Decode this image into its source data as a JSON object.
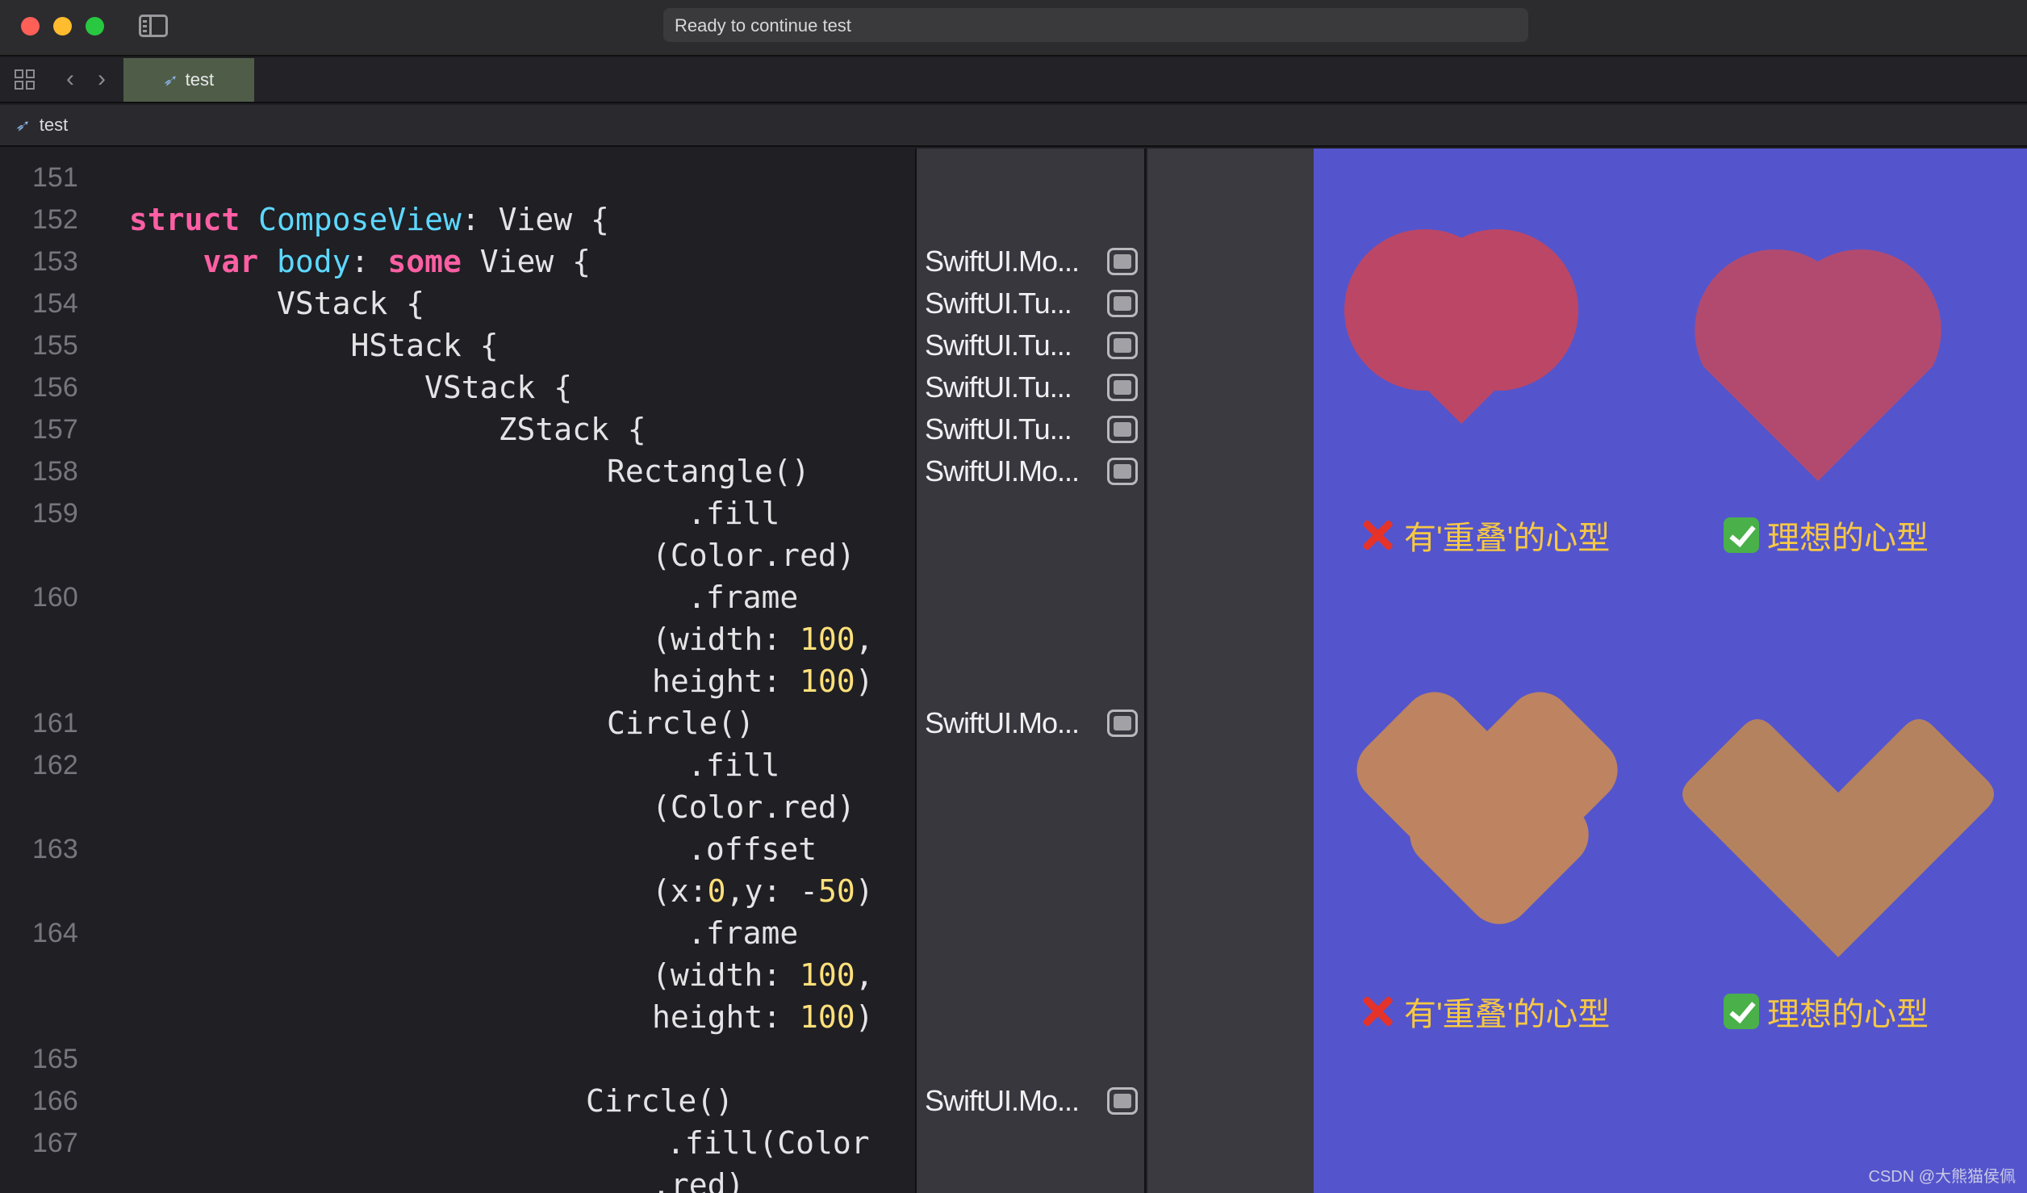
{
  "window": {
    "activity_status": "Ready to continue test"
  },
  "tabs": [
    {
      "label": "test",
      "active": true
    }
  ],
  "breadcrumb": {
    "file": "test"
  },
  "editor": {
    "lines": [
      {
        "number": "151",
        "code": ""
      },
      {
        "number": "152",
        "code": "struct ComposeView: View {"
      },
      {
        "number": "153",
        "code": "    var body: some View {"
      },
      {
        "number": "154",
        "code": "        VStack {"
      },
      {
        "number": "155",
        "code": "            HStack {"
      },
      {
        "number": "156",
        "code": "                VStack {"
      },
      {
        "number": "157",
        "code": "                    ZStack {"
      },
      {
        "number": "158",
        "code": "Rectangle()"
      },
      {
        "number": "159",
        "code": ".fill"
      },
      {
        "number": "",
        "code": "(Color.red)"
      },
      {
        "number": "160",
        "code": ".frame"
      },
      {
        "number": "",
        "code": "(width: 100,"
      },
      {
        "number": "",
        "code": "height: 100)"
      },
      {
        "number": "161",
        "code": "Circle()"
      },
      {
        "number": "162",
        "code": ".fill"
      },
      {
        "number": "",
        "code": "(Color.red)"
      },
      {
        "number": "163",
        "code": ".offset"
      },
      {
        "number": "",
        "code": "(x:0,y: -50)"
      },
      {
        "number": "164",
        "code": ".frame"
      },
      {
        "number": "",
        "code": "(width: 100,"
      },
      {
        "number": "",
        "code": "height: 100)"
      },
      {
        "number": "165",
        "code": ""
      },
      {
        "number": "166",
        "code": "Circle()"
      },
      {
        "number": "167",
        "code": ".fill(Color"
      },
      {
        "number": "",
        "code": ".red)"
      }
    ]
  },
  "results": [
    {
      "line": "153",
      "label": "SwiftUI.Mo..."
    },
    {
      "line": "154",
      "label": "SwiftUI.Tu..."
    },
    {
      "line": "155",
      "label": "SwiftUI.Tu..."
    },
    {
      "line": "156",
      "label": "SwiftUI.Tu..."
    },
    {
      "line": "157",
      "label": "SwiftUI.Tu..."
    },
    {
      "line": "158",
      "label": "SwiftUI.Mo..."
    },
    {
      "line": "161",
      "label": "SwiftUI.Mo..."
    },
    {
      "line": "166",
      "label": "SwiftUI.Mo..."
    }
  ],
  "preview": {
    "captions": {
      "overlap_label": "有'重叠'的心型",
      "ideal_label": "理想的心型"
    },
    "colors": {
      "background": "#5455cc",
      "heart_red": "#b24a70",
      "heart_orange": "#b5825f"
    },
    "watermark": "CSDN @大熊猫侯佩"
  }
}
